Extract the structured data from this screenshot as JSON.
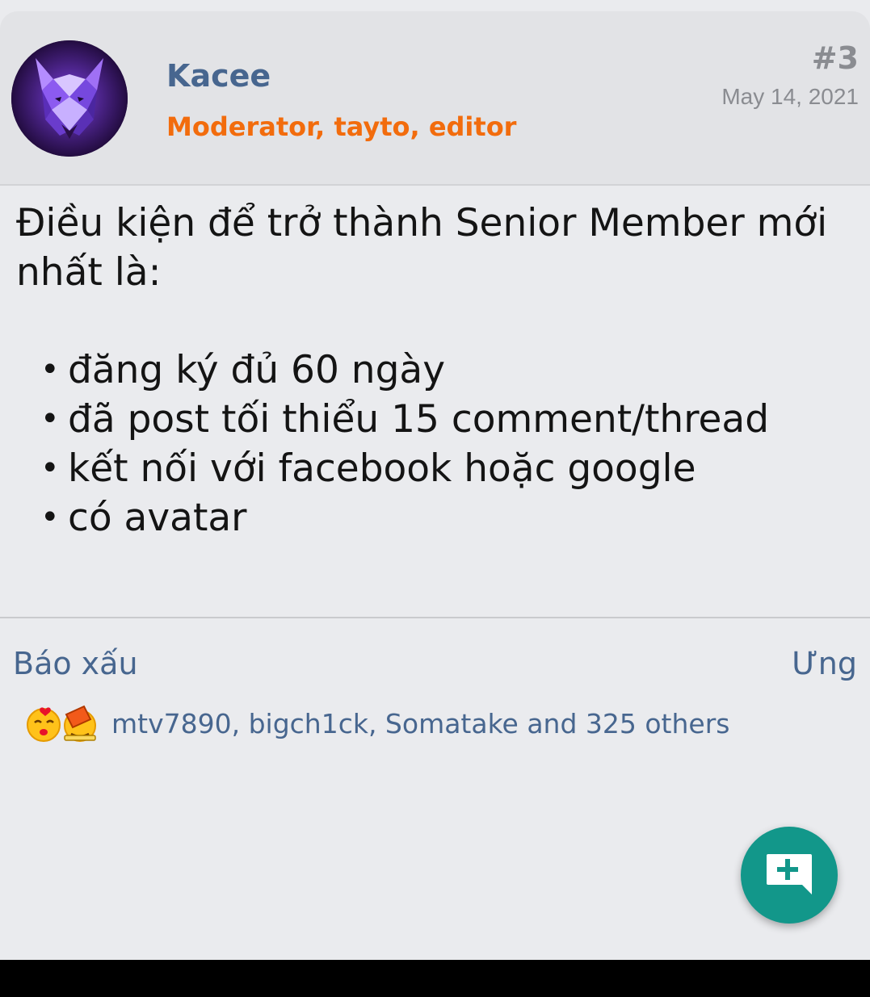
{
  "post": {
    "username": "Kacee",
    "user_title": "Moderator, tayto, editor",
    "number": "#3",
    "date": "May 14, 2021",
    "body_intro": "Điều kiện để trở thành Senior Member mới nhất là:",
    "bullet_char": "•",
    "conditions": [
      "đăng ký đủ 60 ngày",
      "đã post tối thiểu 15 comment/thread",
      "kết nối với facebook hoặc google",
      "có avatar"
    ]
  },
  "actions": {
    "report_label": "Báo xấu",
    "like_label": "Ưng"
  },
  "reactions": {
    "icons": [
      "kiss-emoji-icon",
      "bucket-emoji-icon"
    ],
    "users_text": "mtv7890, bigch1ck, Somatake and 325 others"
  },
  "fab": {
    "icon": "add-comment-icon"
  },
  "colors": {
    "link": "#47668f",
    "user_title": "#f26c0d",
    "fab": "#12978a",
    "meta": "#8a8c91"
  }
}
